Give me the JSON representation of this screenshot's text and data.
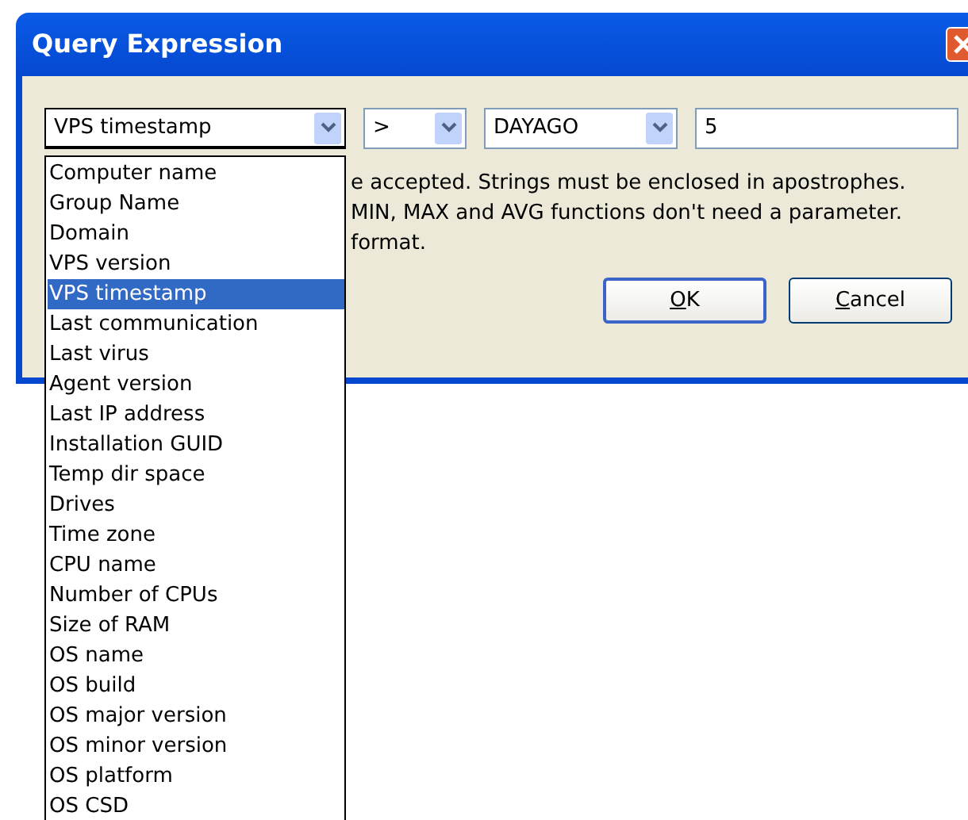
{
  "window": {
    "title": "Query Expression"
  },
  "fields": [
    {
      "kind": "combo",
      "value": "VPS timestamp",
      "expanded": true
    },
    {
      "kind": "combo",
      "value": ">",
      "expanded": false
    },
    {
      "kind": "combo",
      "value": "DAYAGO",
      "expanded": false
    },
    {
      "kind": "text",
      "value": "5"
    }
  ],
  "help_lines": [
    "e accepted. Strings must be enclosed in apostrophes.",
    "MIN, MAX and AVG functions don't need a parameter.",
    "format."
  ],
  "buttons": [
    {
      "label": "OK",
      "default": true
    },
    {
      "label": "Cancel",
      "default": false
    }
  ],
  "dropdown": {
    "items": [
      {
        "label": "Computer name",
        "selected": false
      },
      {
        "label": "Group Name",
        "selected": false
      },
      {
        "label": "Domain",
        "selected": false
      },
      {
        "label": "VPS version",
        "selected": false
      },
      {
        "label": "VPS timestamp",
        "selected": true
      },
      {
        "label": "Last communication",
        "selected": false
      },
      {
        "label": "Last virus",
        "selected": false
      },
      {
        "label": "Agent version",
        "selected": false
      },
      {
        "label": "Last IP address",
        "selected": false
      },
      {
        "label": "Installation GUID",
        "selected": false
      },
      {
        "label": "Temp dir space",
        "selected": false
      },
      {
        "label": "Drives",
        "selected": false
      },
      {
        "label": "Time zone",
        "selected": false
      },
      {
        "label": "CPU name",
        "selected": false
      },
      {
        "label": "Number of CPUs",
        "selected": false
      },
      {
        "label": "Size of RAM",
        "selected": false
      },
      {
        "label": "OS name",
        "selected": false
      },
      {
        "label": "OS build",
        "selected": false
      },
      {
        "label": "OS major version",
        "selected": false
      },
      {
        "label": "OS minor version",
        "selected": false
      },
      {
        "label": "OS platform",
        "selected": false
      },
      {
        "label": "OS CSD",
        "selected": false
      }
    ]
  }
}
